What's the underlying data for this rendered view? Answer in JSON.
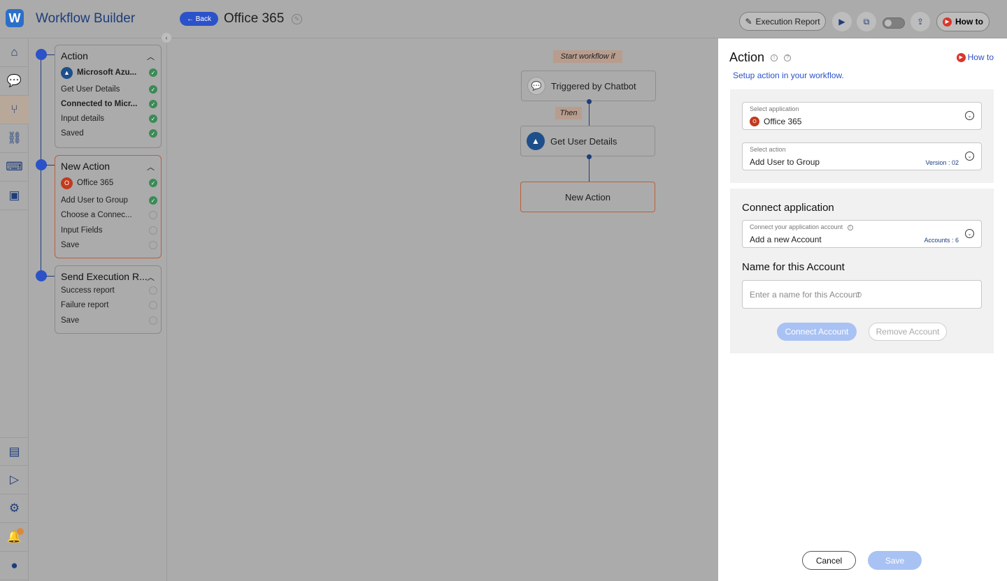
{
  "header": {
    "logo_text": "W",
    "app_title": "Workflow Builder",
    "back_label": "← Back",
    "page_title": "Office 365",
    "execution_report_label": "Execution Report",
    "how_to_label": "How to"
  },
  "colors": {
    "primary": "#2c52c9",
    "success": "#3c8a57",
    "accent_border": "#b9603a",
    "office": "#c23a1e",
    "azure": "#1e4f8a"
  },
  "rail": {
    "top_icons": [
      "home-icon",
      "chat-icon",
      "workflow-icon",
      "link-icon",
      "agent-icon",
      "inbox-icon"
    ],
    "bottom_icons": [
      "form-icon",
      "video-icon",
      "settings-icon",
      "bell-icon",
      "user-icon"
    ]
  },
  "steps": [
    {
      "title": "Action",
      "items": [
        {
          "label": "Microsoft Azu...",
          "done": true,
          "bold": true,
          "app": "azure"
        },
        {
          "label": "Get User Details",
          "done": true,
          "bold": false
        },
        {
          "label": "Connected to Micr...",
          "done": true,
          "bold": true
        },
        {
          "label": "Input details",
          "done": true,
          "bold": false
        },
        {
          "label": "Saved",
          "done": true,
          "bold": false
        }
      ]
    },
    {
      "title": "New Action",
      "items": [
        {
          "label": "Office 365",
          "done": true,
          "bold": false,
          "app": "office"
        },
        {
          "label": "Add User to Group",
          "done": true,
          "bold": false
        },
        {
          "label": "Choose a Connec...",
          "done": false,
          "bold": false
        },
        {
          "label": "Input Fields",
          "done": false,
          "bold": false
        },
        {
          "label": "Save",
          "done": false,
          "bold": false
        }
      ]
    },
    {
      "title": "Send Execution R...",
      "items": [
        {
          "label": "Success report",
          "done": false,
          "bold": false
        },
        {
          "label": "Failure report",
          "done": false,
          "bold": false
        },
        {
          "label": "Save",
          "done": false,
          "bold": false
        }
      ]
    }
  ],
  "canvas": {
    "start_label": "Start workflow if",
    "trigger": "Triggered by Chatbot",
    "then_label": "Then",
    "step1": "Get User Details",
    "step2": "New Action"
  },
  "panel": {
    "title": "Action",
    "how_to": "How to",
    "subtitle": "Setup action in your workflow.",
    "app_field": {
      "label": "Select application",
      "value": "Office 365"
    },
    "action_field": {
      "label": "Select action",
      "value": "Add User to Group",
      "meta": "Version : 02"
    },
    "connect_heading": "Connect application",
    "account_field": {
      "label": "Connect your application account",
      "value": "Add a new Account",
      "meta": "Accounts : 6"
    },
    "name_heading": "Name for this Account",
    "name_placeholder": "Enter a name for this Account",
    "connect_btn": "Connect Account",
    "remove_btn": "Remove Account",
    "cancel_btn": "Cancel",
    "save_btn": "Save"
  }
}
